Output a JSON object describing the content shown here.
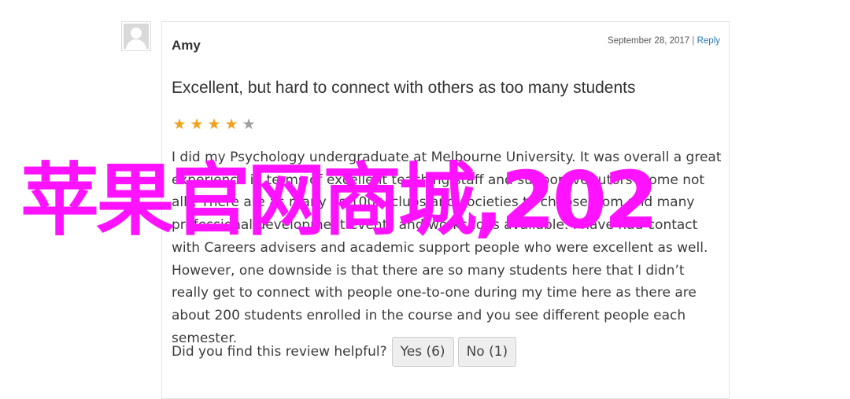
{
  "review": {
    "author": "Amy",
    "date": "September 28, 2017",
    "separator": "|",
    "reply_label": "Reply",
    "title": "Excellent, but hard to connect with others as too many students",
    "rating": 4,
    "rating_max": 5,
    "body": "I did my Psychology undergraduate at Melbourne University. It was overall a great experience in terms of excellent teaching staff and supportive tutors (some not all). There are as many as 100+ clubs and societies to choose from and many professional development events and workshops available. I have had contact with Careers advisers and academic support people who were excellent as well. However, one downside is that there are so many students here that I didn’t really get to connect with people one-to-one during my time here as there are about 200 students enrolled in the course and you see different people each semester.",
    "helpful_prompt": "Did you find this review helpful?",
    "yes_label": "Yes (6)",
    "no_label": "No (1)"
  },
  "overlay": {
    "watermark_text": "苹果官网商城,202"
  },
  "colors": {
    "star_on": "#f0a21e",
    "star_off": "#9e9e9e",
    "link": "#2a7ab0",
    "watermark": "#ff12ff"
  },
  "icons": {
    "avatar": "default-avatar-icon",
    "star": "star-icon"
  }
}
